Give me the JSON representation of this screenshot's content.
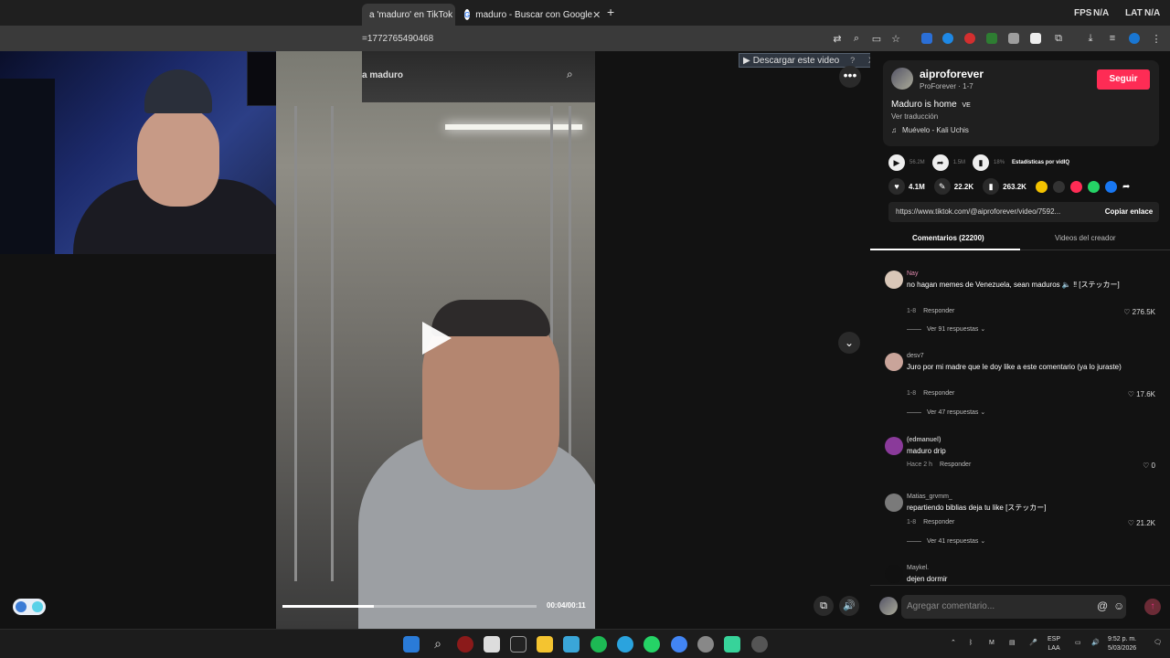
{
  "browser": {
    "tabs": [
      {
        "label": "a 'maduro' en TikTok |"
      },
      {
        "label": "maduro - Buscar con Google"
      }
    ],
    "url": "=1772765490468",
    "fps_label": "FPS",
    "fps_value": "N/A",
    "lat_label": "LAT",
    "lat_value": "N/A"
  },
  "video": {
    "search_text": "a maduro",
    "time": "00:04/00:11",
    "progress": 0.36,
    "download_button": "Descargar este video",
    "download_help": "?",
    "download_close": "X"
  },
  "post": {
    "username": "aiproforever",
    "subtitle": "ProForever · 1-7",
    "follow_label": "Seguir",
    "description": "Maduro is home",
    "description_suffix": "VE",
    "translate": "Ver traducción",
    "music": "Muévelo - Kali Uchis",
    "views": "56.2M",
    "shares_count": "1.5M",
    "stat_pct": "18%",
    "stats_label": "Estadísticas por vidIQ",
    "likes": "4.1M",
    "comments": "22.2K",
    "saves": "263.2K",
    "link": "https://www.tiktok.com/@aiproforever/video/7592...",
    "copy_label": "Copiar enlace"
  },
  "tabs": {
    "comments": "Comentarios (22200)",
    "creator_videos": "Videos del creador"
  },
  "comments": [
    {
      "name": "Nay",
      "text": "no hagan memes de Venezuela, sean maduros 🔈 ‼ [ステッカー]",
      "date": "1-8",
      "reply": "Responder",
      "likes": "276.5K",
      "replies": "Ver 91 respuestas"
    },
    {
      "name": "desv7",
      "text": "Juro por mi madre que le doy like a este comentario (ya lo juraste)",
      "date": "1-8",
      "reply": "Responder",
      "likes": "17.6K",
      "replies": "Ver 47 respuestas"
    },
    {
      "name": "(edmanuel)",
      "text": "maduro drip",
      "date": "Hace 2 h",
      "reply": "Responder",
      "likes": "0",
      "replies": ""
    },
    {
      "name": "Matias_grvmm_",
      "text": "repartiendo biblias deja tu like [ステッカー]",
      "date": "1-8",
      "reply": "Responder",
      "likes": "21.2K",
      "replies": "Ver 41 respuestas"
    },
    {
      "name": "Maykel.",
      "text": "dejen dormir",
      "date": "",
      "reply": "",
      "likes": "",
      "replies": ""
    }
  ],
  "comment_input": {
    "placeholder": "Agregar comentario..."
  },
  "taskbar": {
    "lang": "ESP",
    "lang2": "LAA",
    "time": "9:52 p. m.",
    "date": "5/03/2026"
  }
}
